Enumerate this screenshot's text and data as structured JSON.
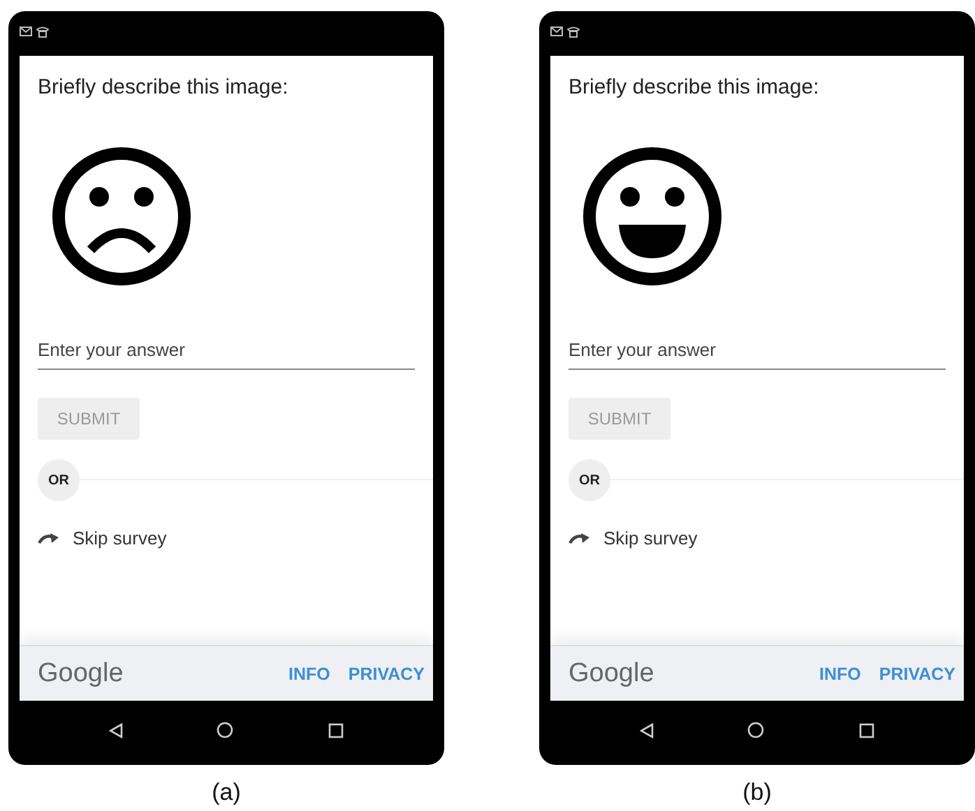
{
  "panels": [
    {
      "caption": "(a)",
      "face": {
        "kind": "sad"
      },
      "prompt": "Briefly describe this image:",
      "answer": {
        "placeholder": "Enter your answer"
      },
      "submit": {
        "label": "SUBMIT",
        "disabled": true
      },
      "or_label": "OR",
      "skip_label": "Skip survey",
      "footer": {
        "brand": "Google",
        "links": [
          "INFO",
          "PRIVACY"
        ]
      }
    },
    {
      "caption": "(b)",
      "face": {
        "kind": "happy"
      },
      "prompt": "Briefly describe this image:",
      "answer": {
        "placeholder": "Enter your answer"
      },
      "submit": {
        "label": "SUBMIT",
        "disabled": true
      },
      "or_label": "OR",
      "skip_label": "Skip survey",
      "footer": {
        "brand": "Google",
        "links": [
          "INFO",
          "PRIVACY"
        ]
      }
    }
  ]
}
